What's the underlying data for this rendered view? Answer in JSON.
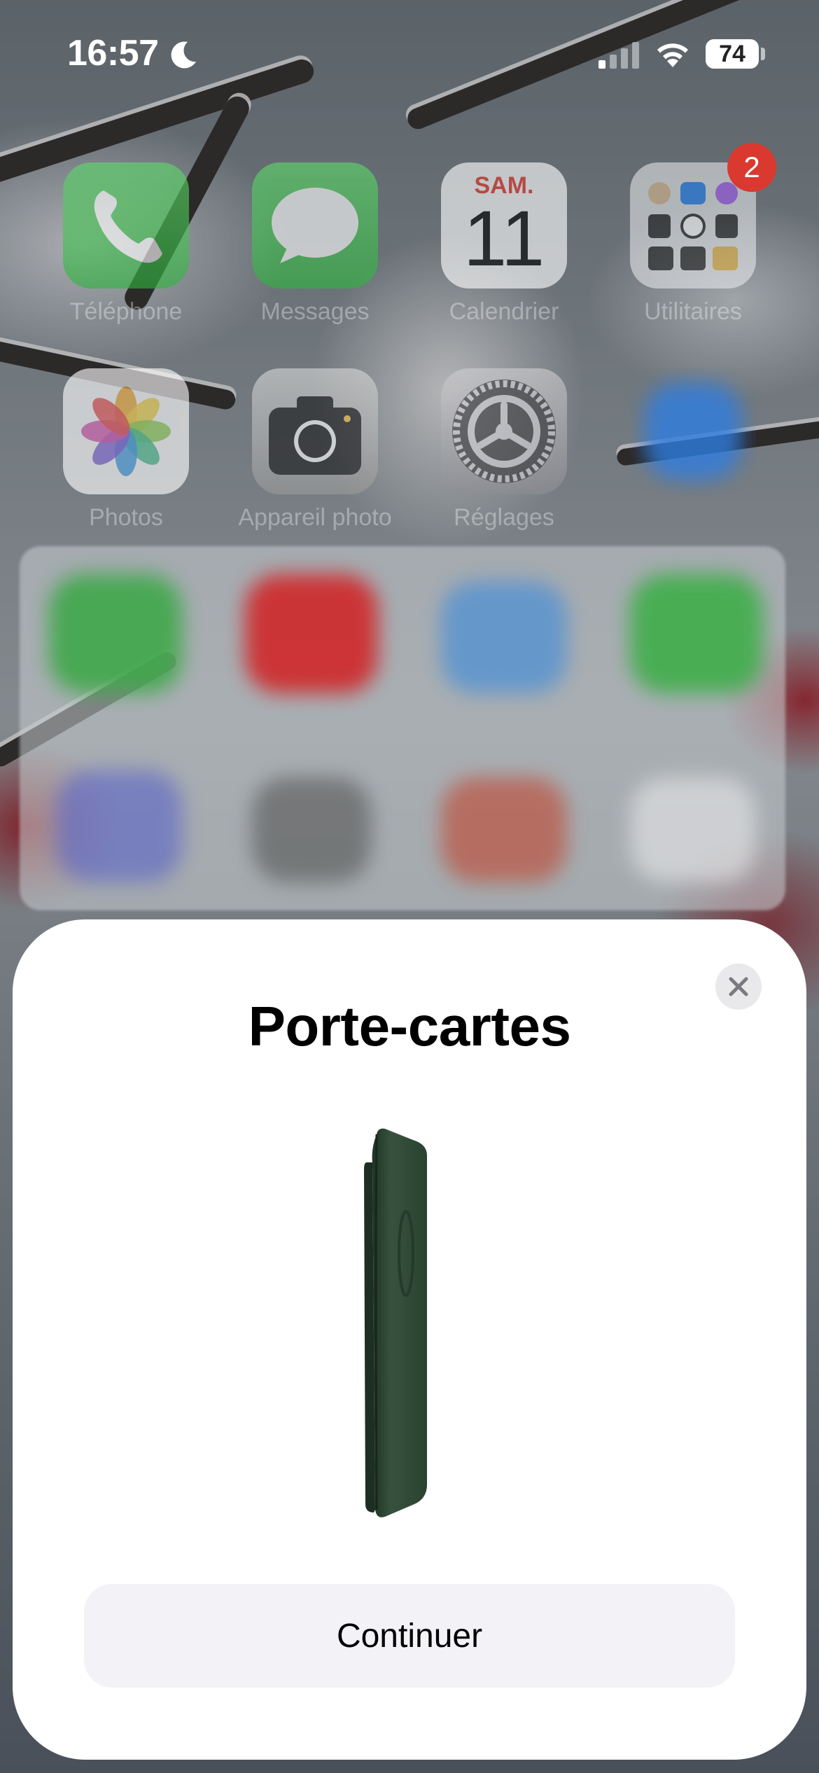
{
  "status_bar": {
    "time": "16:57",
    "battery": "74"
  },
  "home": {
    "apps": [
      {
        "label": "Téléphone"
      },
      {
        "label": "Messages"
      },
      {
        "label": "Calendrier",
        "day": "SAM.",
        "date": "11"
      },
      {
        "label": "Utilitaires",
        "badge": "2"
      },
      {
        "label": "Photos"
      },
      {
        "label": "Appareil photo"
      },
      {
        "label": "Réglages"
      }
    ]
  },
  "sheet": {
    "title": "Porte-cartes",
    "continue_label": "Continuer"
  },
  "colors": {
    "phone_green": "#34b84a",
    "calendar_red": "#e6352b",
    "wallet_green": "#2f4a37",
    "button_bg": "#f2f2f7"
  }
}
